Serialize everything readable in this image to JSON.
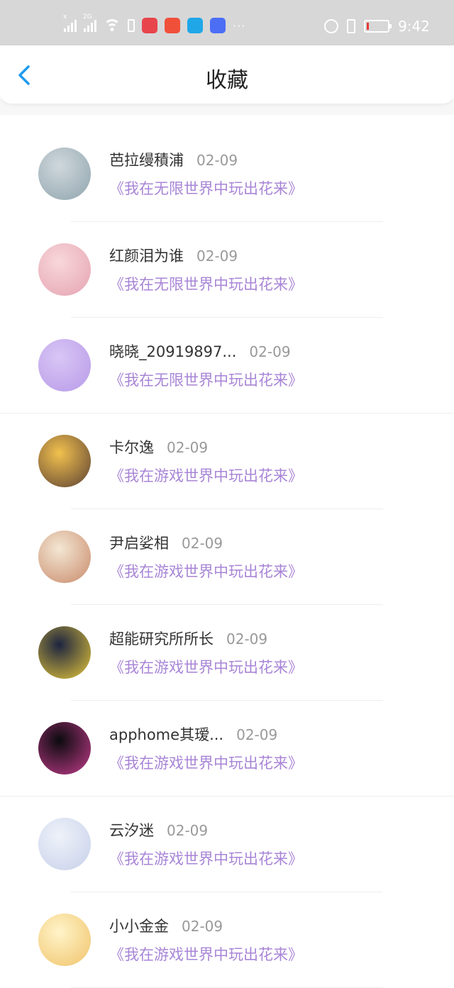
{
  "status_bar": {
    "time": "9:42",
    "signal1_tag": "x",
    "signal2_tag": "2G",
    "app_icon_colors": [
      "#e8444c",
      "#f0503a",
      "#1fa7e8",
      "#4c6ef5"
    ]
  },
  "header": {
    "title": "收藏",
    "back_icon": "chevron-left-icon",
    "accent_color": "#1e9bf0"
  },
  "favorites": [
    {
      "name": "芭拉缦積浦",
      "date": "02-09",
      "book": "《我在无限世界中玩出花来》",
      "avatar_colors": [
        "#cfd8dc",
        "#90a4ae"
      ],
      "divider": "short"
    },
    {
      "name": "红颜泪为谁",
      "date": "02-09",
      "book": "《我在无限世界中玩出花来》",
      "avatar_colors": [
        "#f8d7da",
        "#e5a3b1"
      ],
      "divider": "short"
    },
    {
      "name": "晓晓_20919897...",
      "date": "02-09",
      "book": "《我在无限世界中玩出花来》",
      "avatar_colors": [
        "#d9c6f5",
        "#b79ae8"
      ],
      "divider": "full"
    },
    {
      "name": "卡尔逸",
      "date": "02-09",
      "book": "《我在游戏世界中玩出花来》",
      "avatar_colors": [
        "#f2c14e",
        "#5b4033"
      ],
      "divider": "short"
    },
    {
      "name": "尹启娑相",
      "date": "02-09",
      "book": "《我在游戏世界中玩出花来》",
      "avatar_colors": [
        "#f3e7d3",
        "#c98a6b"
      ],
      "divider": "short"
    },
    {
      "name": "超能研究所所长",
      "date": "02-09",
      "book": "《我在游戏世界中玩出花来》",
      "avatar_colors": [
        "#1d2440",
        "#e5c73a"
      ],
      "divider": "short"
    },
    {
      "name": "apphome其瑷...",
      "date": "02-09",
      "book": "《我在游戏世界中玩出花来》",
      "avatar_colors": [
        "#0b0b0f",
        "#c23b8a"
      ],
      "divider": "full"
    },
    {
      "name": "云汐迷",
      "date": "02-09",
      "book": "《我在游戏世界中玩出花来》",
      "avatar_colors": [
        "#eef2f9",
        "#c7d0ea"
      ],
      "divider": "short"
    },
    {
      "name": "小小金金",
      "date": "02-09",
      "book": "《我在游戏世界中玩出花来》",
      "avatar_colors": [
        "#fff4c9",
        "#f0c36a"
      ],
      "divider": "short"
    }
  ]
}
